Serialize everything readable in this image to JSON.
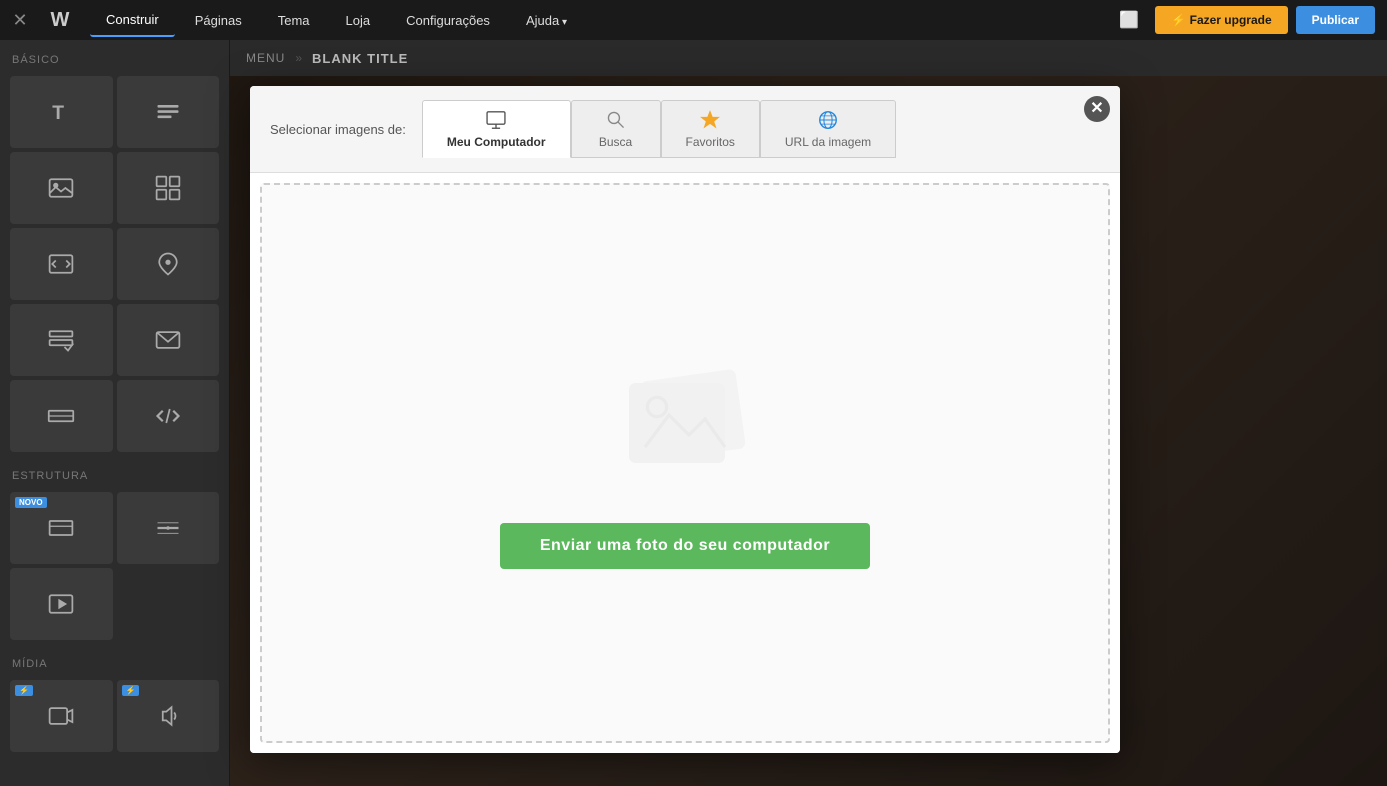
{
  "topbar": {
    "close_label": "✕",
    "logo_label": "W",
    "nav_items": [
      {
        "label": "Construir",
        "active": true,
        "has_arrow": false
      },
      {
        "label": "Páginas",
        "active": false,
        "has_arrow": false
      },
      {
        "label": "Tema",
        "active": false,
        "has_arrow": false
      },
      {
        "label": "Loja",
        "active": false,
        "has_arrow": false
      },
      {
        "label": "Configurações",
        "active": false,
        "has_arrow": false
      },
      {
        "label": "Ajuda",
        "active": false,
        "has_arrow": true
      }
    ],
    "upgrade_label": "⚡ Fazer upgrade",
    "publish_label": "Publicar",
    "monitor_label": "⬜"
  },
  "breadcrumb": {
    "menu_label": "MENU",
    "separator": "»",
    "title": "BLANK TITLE"
  },
  "sidebar": {
    "section_basic": "BÁSICO",
    "section_structure": "ESTRUTURA",
    "section_media": "MÍDIA",
    "items_basic": [
      {
        "icon": "text-icon",
        "label": ""
      },
      {
        "icon": "paragraph-icon",
        "label": ""
      },
      {
        "icon": "image-icon",
        "label": ""
      },
      {
        "icon": "grid-icon",
        "label": ""
      },
      {
        "icon": "image-embed-icon",
        "label": ""
      },
      {
        "icon": "map-pin-icon",
        "label": ""
      },
      {
        "icon": "form-icon",
        "label": ""
      },
      {
        "icon": "mail-icon",
        "label": ""
      },
      {
        "icon": "strip-icon",
        "label": ""
      },
      {
        "icon": "code-icon",
        "label": ""
      }
    ],
    "items_structure": [
      {
        "icon": "section-icon",
        "label": "",
        "badge": "NOVO"
      },
      {
        "icon": "divider-icon",
        "label": ""
      },
      {
        "icon": "embed-icon",
        "label": ""
      }
    ],
    "items_media": [
      {
        "icon": "bolt-video-icon",
        "label": "",
        "badge": true
      },
      {
        "icon": "bolt-audio-icon",
        "label": "",
        "badge": true
      }
    ]
  },
  "modal": {
    "close_label": "✕",
    "header_label": "Selecionar imagens de:",
    "tabs": [
      {
        "label": "Meu Computador",
        "icon": "computer-icon",
        "active": true
      },
      {
        "label": "Busca",
        "icon": "search-icon",
        "active": false
      },
      {
        "label": "Favoritos",
        "icon": "star-icon",
        "active": false
      },
      {
        "label": "URL da imagem",
        "icon": "globe-icon",
        "active": false
      }
    ],
    "upload_button_label": "Enviar uma foto do seu computador"
  }
}
